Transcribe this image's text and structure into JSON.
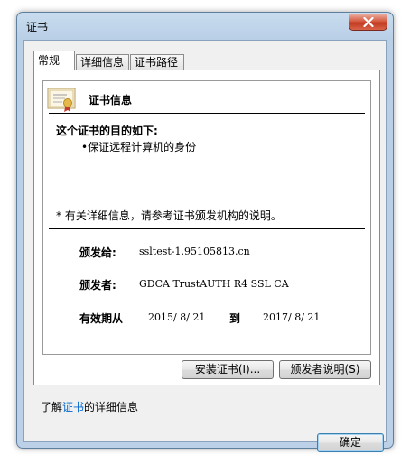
{
  "window": {
    "title": "证书",
    "colors": {
      "accent": "#3c7fb1",
      "link": "#0066cc"
    }
  },
  "tabs": [
    {
      "label": "常规"
    },
    {
      "label": "详细信息"
    },
    {
      "label": "证书路径"
    }
  ],
  "general": {
    "heading": "证书信息",
    "purpose_title": "这个证书的目的如下:",
    "purpose_items": [
      "•保证远程计算机的身份"
    ],
    "note": "* 有关详细信息，请参考证书颁发机构的说明。",
    "issued_to_label": "颁发给:",
    "issued_to_value": "ssltest-1.95105813.cn",
    "issued_by_label": "颁发者:",
    "issued_by_value": "GDCA TrustAUTH R4 SSL CA",
    "valid_label": "有效期从",
    "valid_from": "2015/ 8/ 21",
    "valid_to_word": "到",
    "valid_to": "2017/ 8/ 21"
  },
  "buttons": {
    "install": "安装证书(I)...",
    "issuer_statement": "颁发者说明(S)",
    "ok": "确定"
  },
  "learn_more": {
    "prefix": "了解",
    "link": "证书",
    "suffix": "的详细信息"
  }
}
